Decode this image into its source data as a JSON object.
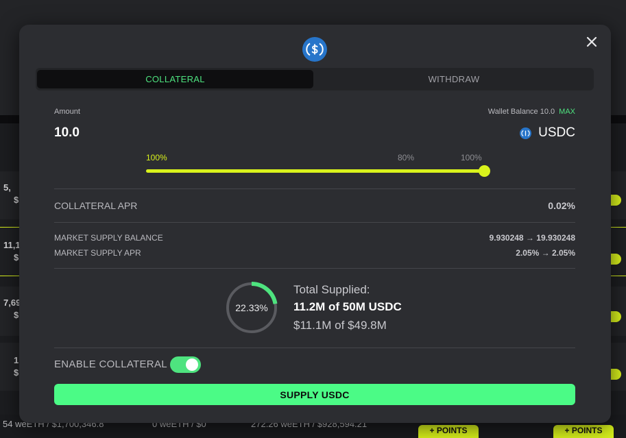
{
  "background": {
    "row_fragments": [
      "5,",
      "$",
      "11,1(",
      "$",
      "7,69",
      "$",
      "1",
      "$"
    ],
    "bottom_row": [
      "54 weETH / $1,700,346.8",
      "0 weETH / $0",
      "272.26 weETH / $928,594.21"
    ],
    "points_label": "+ POINTS"
  },
  "modal": {
    "tabs": [
      {
        "label": "COLLATERAL",
        "active": true
      },
      {
        "label": "WITHDRAW",
        "active": false
      }
    ],
    "amount_label": "Amount",
    "amount_value": "10.0",
    "wallet_balance_label": "Wallet Balance 10.0",
    "max_label": "MAX",
    "asset_symbol": "USDC",
    "slider": {
      "current_label": "100%",
      "marks": [
        "80%",
        "100%"
      ],
      "value_fraction": 1.0
    },
    "collateral_apr": {
      "label": "COLLATERAL APR",
      "value": "0.02%"
    },
    "market_supply_balance": {
      "label": "MARKET SUPPLY BALANCE",
      "value": "9.930248 → 19.930248"
    },
    "market_supply_apr": {
      "label": "MARKET SUPPLY APR",
      "value": "2.05% → 2.05%"
    },
    "total_supplied": {
      "percent_label": "22.33%",
      "percent_value": 0.2233,
      "title": "Total Supplied:",
      "amount": "11.2M of 50M USDC",
      "usd": "$11.1M of $49.8M"
    },
    "enable_collateral": {
      "label": "ENABLE COLLATERAL",
      "enabled": true
    },
    "supply_button_label": "SUPPLY USDC"
  },
  "colors": {
    "accent_green": "#4ee37f",
    "button_green": "#4bfb86",
    "slider_yellow": "#d9f21c",
    "usdc_blue": "#2775ca"
  },
  "icons": [
    "usdc-icon",
    "close-icon"
  ]
}
